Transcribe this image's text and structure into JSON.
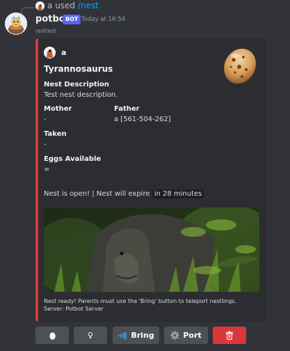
{
  "reply": {
    "user": "a",
    "used": "used",
    "command": "/nest"
  },
  "message": {
    "author": "potbot",
    "bot_tag": "BOT",
    "timestamp": "Today at 16:54",
    "edited": "(edited)"
  },
  "embed": {
    "accent_color": "#da373c",
    "author_name": "a",
    "title": "Tyrannosaurus",
    "description_label": "Nest Description",
    "description_value": "Test nest description.",
    "mother_label": "Mother",
    "mother_value": "-",
    "father_label": "Father",
    "father_value": "a [561-504-262]",
    "taken_label": "Taken",
    "taken_value": "-",
    "eggs_label": "Eggs Available",
    "eggs_value": "∞",
    "status_prefix": "Nest is open! | Nest will expire ",
    "status_expire": "in 28 minutes",
    "footer_line1": "Nest ready! Parents must use the 'Bring' button to teleport nestlings.",
    "footer_line2": "Server: Potbot Server"
  },
  "buttons": {
    "egg_icon": "egg-icon",
    "female_icon": "female-symbol-icon",
    "female_symbol": "♀",
    "bring_icon": "teleport-icon",
    "bring_label": "Bring",
    "port_icon": "gear-icon",
    "port_label": "Port",
    "delete_icon": "trash-icon"
  }
}
